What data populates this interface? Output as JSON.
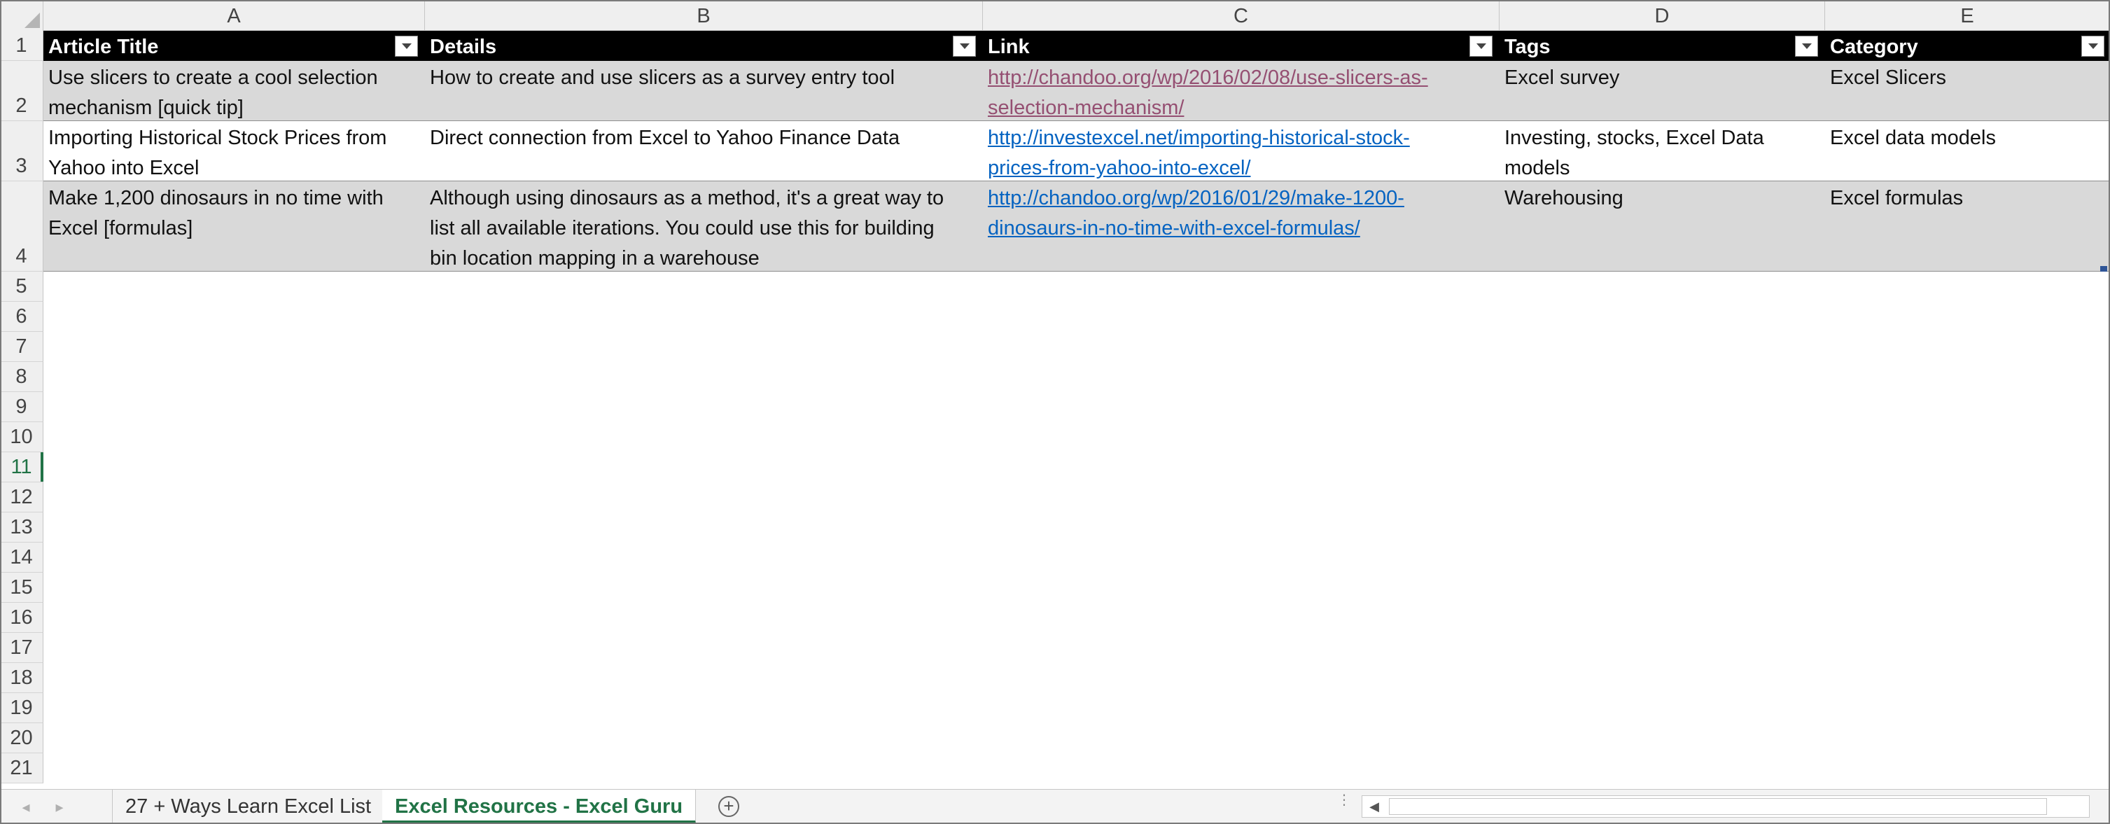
{
  "columns": [
    "A",
    "B",
    "C",
    "D",
    "E"
  ],
  "rows": [
    "1",
    "2",
    "3",
    "4",
    "5",
    "6",
    "7",
    "8",
    "9",
    "10",
    "11",
    "12",
    "13",
    "14",
    "15",
    "16",
    "17",
    "18",
    "19",
    "20",
    "21"
  ],
  "table": {
    "headers": [
      "Article Title",
      "Details",
      "Link",
      "Tags",
      "Category"
    ],
    "rows": [
      {
        "title": "Use slicers to create a cool selection\nmechanism [quick tip]",
        "details": "How to create and use slicers as a survey entry tool",
        "link": "http://chandoo.org/wp/2016/02/08/use-slicers-as-\nselection-mechanism/",
        "tags": "Excel survey",
        "category": "Excel Slicers"
      },
      {
        "title": "Importing Historical Stock Prices from\nYahoo into Excel",
        "details": "Direct connection from Excel to Yahoo Finance Data",
        "link": "http://investexcel.net/importing-historical-stock-\nprices-from-yahoo-into-excel/",
        "tags": "Investing, stocks, Excel Data\nmodels",
        "category": "Excel data models"
      },
      {
        "title": "Make 1,200 dinosaurs in no time with\nExcel [formulas]",
        "details": "Although using dinosaurs as a method, it's a great way to\nlist all available iterations.  You could use this for building\nbin location mapping in a warehouse",
        "link": "http://chandoo.org/wp/2016/01/29/make-1200-\ndinosaurs-in-no-time-with-excel-formulas/",
        "tags": "Warehousing",
        "category": "Excel formulas"
      }
    ]
  },
  "sheet_tabs": [
    {
      "label": "27 + Ways Learn Excel List",
      "active": false
    },
    {
      "label": "Excel Resources - Excel Guru",
      "active": true
    }
  ],
  "selected_row": "11",
  "icons": {
    "filter": "filter-dropdown-icon",
    "add_sheet": "plus-circle-icon",
    "scroll_left": "arrow-left-icon",
    "sheet_prev": "chevron-left-icon",
    "sheet_next": "chevron-right-icon"
  },
  "colors": {
    "accent": "#217346",
    "link": "#0563c1",
    "visited_link": "#954f72",
    "band": "#d9d9d9",
    "header_bg": "#000000"
  }
}
